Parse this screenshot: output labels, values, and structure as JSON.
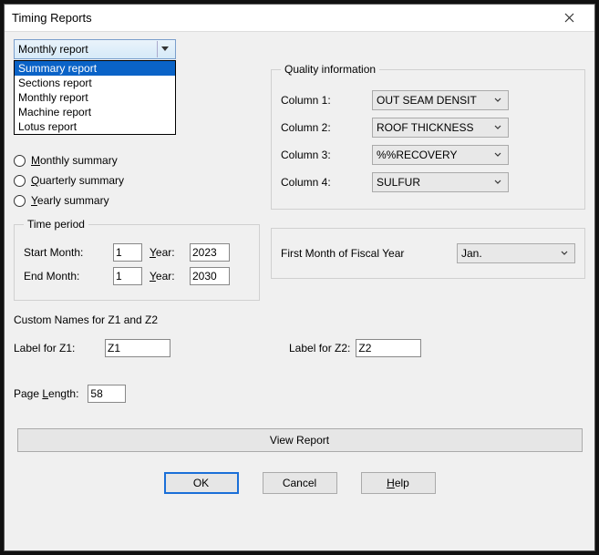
{
  "window": {
    "title": "Timing Reports"
  },
  "report_combo": {
    "selected": "Monthly report",
    "options": [
      "Summary report",
      "Sections report",
      "Monthly report",
      "Machine report",
      "Lotus report"
    ],
    "highlighted_index": 0
  },
  "summary_group": {
    "monthly": "Monthly summary",
    "quarterly": "Quarterly summary",
    "yearly": "Yearly summary"
  },
  "quality": {
    "legend": "Quality information",
    "rows": [
      {
        "label": "Column 1:",
        "value": "OUT SEAM DENSIT"
      },
      {
        "label": "Column 2:",
        "value": "ROOF THICKNESS"
      },
      {
        "label": "Column 3:",
        "value": "%%RECOVERY"
      },
      {
        "label": "Column 4:",
        "value": "SULFUR"
      }
    ]
  },
  "time_period": {
    "legend": "Time period",
    "start_label": "Start Month:",
    "end_label": "End Month:",
    "year_label": "Year:",
    "start_month": "1",
    "start_year": "2023",
    "end_month": "1",
    "end_year": "2030"
  },
  "fiscal": {
    "label": "First Month of Fiscal Year",
    "value": "Jan."
  },
  "custom_names": {
    "heading": "Custom Names for Z1 and Z2",
    "z1_label": "Label for Z1:",
    "z1_value": "Z1",
    "z2_label": "Label for Z2:",
    "z2_value": "Z2"
  },
  "page_length": {
    "label": "Page Length:",
    "value": "58"
  },
  "buttons": {
    "view_report": "View Report",
    "ok": "OK",
    "cancel": "Cancel",
    "help": "Help"
  },
  "underlined": {
    "M": "M",
    "onthly": "onthly summary",
    "Q": "Q",
    "uarterly": "uarterly summary",
    "Y": "Y",
    "early": "early summary",
    "Year_Y": "Y",
    "ear": "ear:",
    "L": "L",
    "ength": "ength:",
    "H": "H",
    "elp": "elp"
  }
}
